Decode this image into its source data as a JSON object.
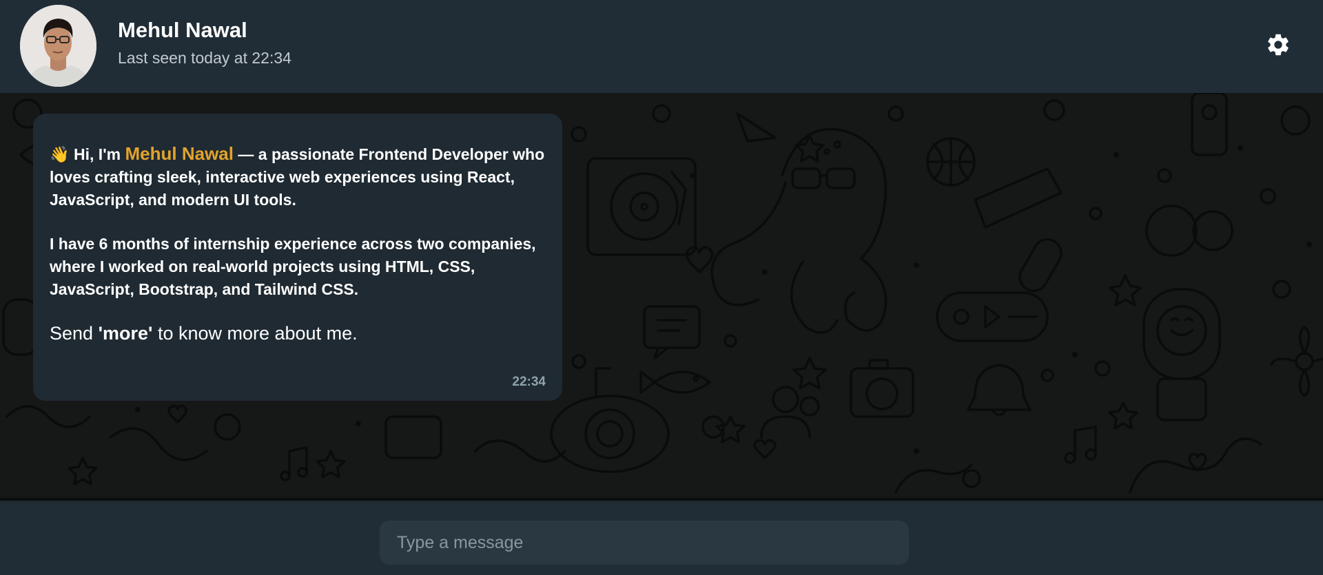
{
  "header": {
    "contact_name": "Mehul Nawal",
    "last_seen": "Last seen today at 22:34"
  },
  "message": {
    "wave_emoji": "👋",
    "intro_prefix": " Hi, I'm ",
    "intro_name": "Mehul Nawal",
    "intro_suffix": " — a passionate Frontend Developer who loves crafting sleek, interactive web experiences using React, JavaScript, and modern UI tools.",
    "experience": "I have 6 months of internship experience across two companies, where I worked on real-world projects using HTML, CSS, JavaScript, Bootstrap, and Tailwind CSS.",
    "send_prefix": "Send ",
    "send_keyword": "'more'",
    "send_suffix": " to know more about me.",
    "time": "22:34"
  },
  "composer": {
    "placeholder": "Type a message",
    "value": ""
  },
  "icons": {
    "settings": "gear-icon",
    "avatar": "profile-photo"
  },
  "colors": {
    "header_bg": "#212d36",
    "bubble_bg": "#1f2a32",
    "name_highlight": "#e3a32b",
    "chat_bg": "#161717"
  }
}
